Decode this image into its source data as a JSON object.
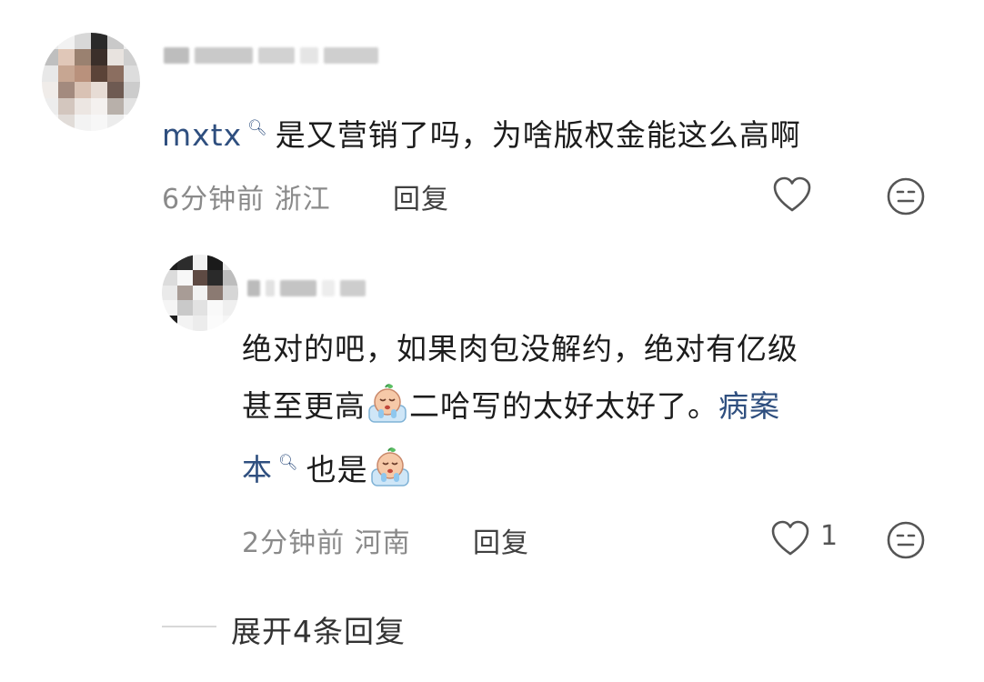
{
  "comment": {
    "username": "mxtx",
    "mention_icon": "search-icon",
    "text": "是又营销了吗，为啥版权金能这么高啊",
    "time": "6分钟前",
    "location": "浙江",
    "reply_label": "回复",
    "like_icon": "heart-outline-icon",
    "dislike_icon": "neutral-face-icon"
  },
  "reply": {
    "line1": "绝对的吧，如果肉包没解约，绝对有亿级",
    "line2_a": "甚至更高",
    "line2_b": "二哈写的太好太好了。",
    "mention_a": "病案",
    "mention_b": "本",
    "line3_tail": "也是",
    "emoji_icon": "crying-emoji-icon",
    "time": "2分钟前",
    "location": "河南",
    "reply_label": "回复",
    "like_count": "1",
    "like_icon": "heart-outline-icon",
    "dislike_icon": "neutral-face-icon"
  },
  "expand_label": "展开4条回复",
  "colors": {
    "mention": "#2f4f7f",
    "meta": "#8a8a8a",
    "text": "#1c1c1c"
  }
}
